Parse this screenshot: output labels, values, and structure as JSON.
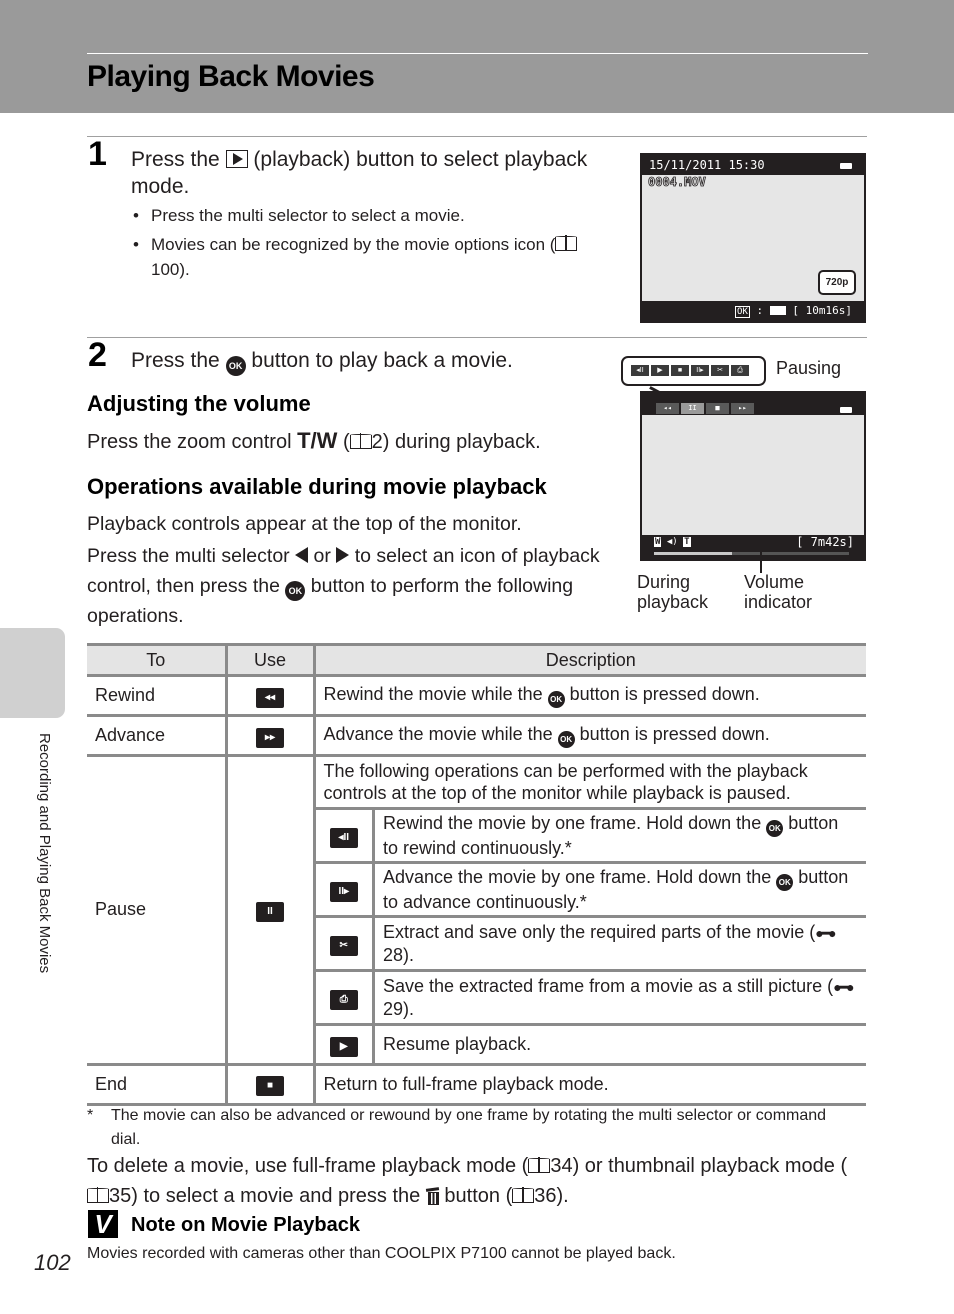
{
  "header": {
    "title": "Playing Back Movies"
  },
  "side_tab": {
    "label": "Recording and Playing Back Movies"
  },
  "step1": {
    "number": "1",
    "text_before": "Press the",
    "text_after": "(playback) button to select playback mode.",
    "bullets": [
      "Press the multi selector to select a movie.",
      "Movies can be recognized by the movie options icon (",
      "100)."
    ]
  },
  "screen1": {
    "datetime": "15/11/2011  15:30",
    "filename": "0004.MOV",
    "resolution_badge": "720p",
    "bottom_ok": "OK",
    "bottom_sep": ":",
    "bottom_time": "[  10m16s]"
  },
  "step2": {
    "number": "2",
    "text_before": "Press the",
    "text_after": "button to play back a movie."
  },
  "volume_section": {
    "heading": "Adjusting the volume",
    "text_before": "Press the zoom control",
    "tw": "T/W",
    "ref_open": " (",
    "ref": "2) during playback."
  },
  "ops_section": {
    "heading": "Operations available during movie playback",
    "line1": "Playback controls appear at the top of the monitor.",
    "line2_a": "Press the multi selector",
    "line2_or": "or",
    "line2_b": "to select an icon of playback control, then press the",
    "line2_c": "button to perform the following operations."
  },
  "figure2": {
    "pausing_label": "Pausing",
    "pause_controls": [
      "◂II",
      "▶",
      "■",
      "II▸",
      "✂",
      "⎙"
    ],
    "playback_controls": [
      "◂◂",
      "II",
      "■",
      "▸▸"
    ],
    "selected_control_index": 1,
    "time": "[    7m42s]",
    "vol_w": "W",
    "vol_t": "T",
    "progress_fraction": 0.4,
    "label_during": "During playback",
    "label_volume": "Volume indicator"
  },
  "table": {
    "headers": [
      "To",
      "Use",
      "Description"
    ],
    "rows": [
      {
        "to": "Rewind",
        "icon": "rewind-icon",
        "glyph": "◂◂",
        "desc_a": "Rewind the movie while the",
        "desc_b": "button is pressed down."
      },
      {
        "to": "Advance",
        "icon": "fast-forward-icon",
        "glyph": "▸▸",
        "desc_a": "Advance the movie while the",
        "desc_b": "button is pressed down."
      },
      {
        "to": "Pause",
        "icon": "pause-icon",
        "glyph": "II",
        "intro": "The following operations can be performed with the playback controls at the top of the monitor while playback is paused.",
        "sub": [
          {
            "icon": "frame-rewind-icon",
            "glyph": "◂II",
            "text_a": "Rewind the movie by one frame. Hold down the",
            "text_b": "button to rewind continuously.*"
          },
          {
            "icon": "frame-advance-icon",
            "glyph": "II▸",
            "text_a": "Advance the movie by one frame. Hold down the",
            "text_b": "button to advance continuously.*"
          },
          {
            "icon": "scissors-icon",
            "glyph": "✂",
            "text_a": "Extract and save only the required parts of the movie (",
            "ref": "28)."
          },
          {
            "icon": "save-frame-icon",
            "glyph": "⎙",
            "text_a": "Save the extracted frame from a movie as a still picture (",
            "ref": "29)."
          },
          {
            "icon": "play-icon",
            "glyph": "▶",
            "text_a": "Resume playback."
          }
        ]
      },
      {
        "to": "End",
        "icon": "stop-icon",
        "glyph": "■",
        "desc_a": "Return to full-frame playback mode."
      }
    ]
  },
  "footnote": {
    "star": "*",
    "text": "The movie can also be advanced or rewound by one frame by rotating the multi selector or command dial."
  },
  "delete_text": {
    "a": "To delete a movie, use full-frame playback mode (",
    "b": "34) or thumbnail playback mode (",
    "c": "35) to select a movie and press the",
    "d": "button (",
    "e": "36)."
  },
  "note": {
    "icon": "V",
    "title": "Note on Movie Playback",
    "text": "Movies recorded with cameras other than COOLPIX P7100 cannot be played back."
  },
  "page_number": "102"
}
